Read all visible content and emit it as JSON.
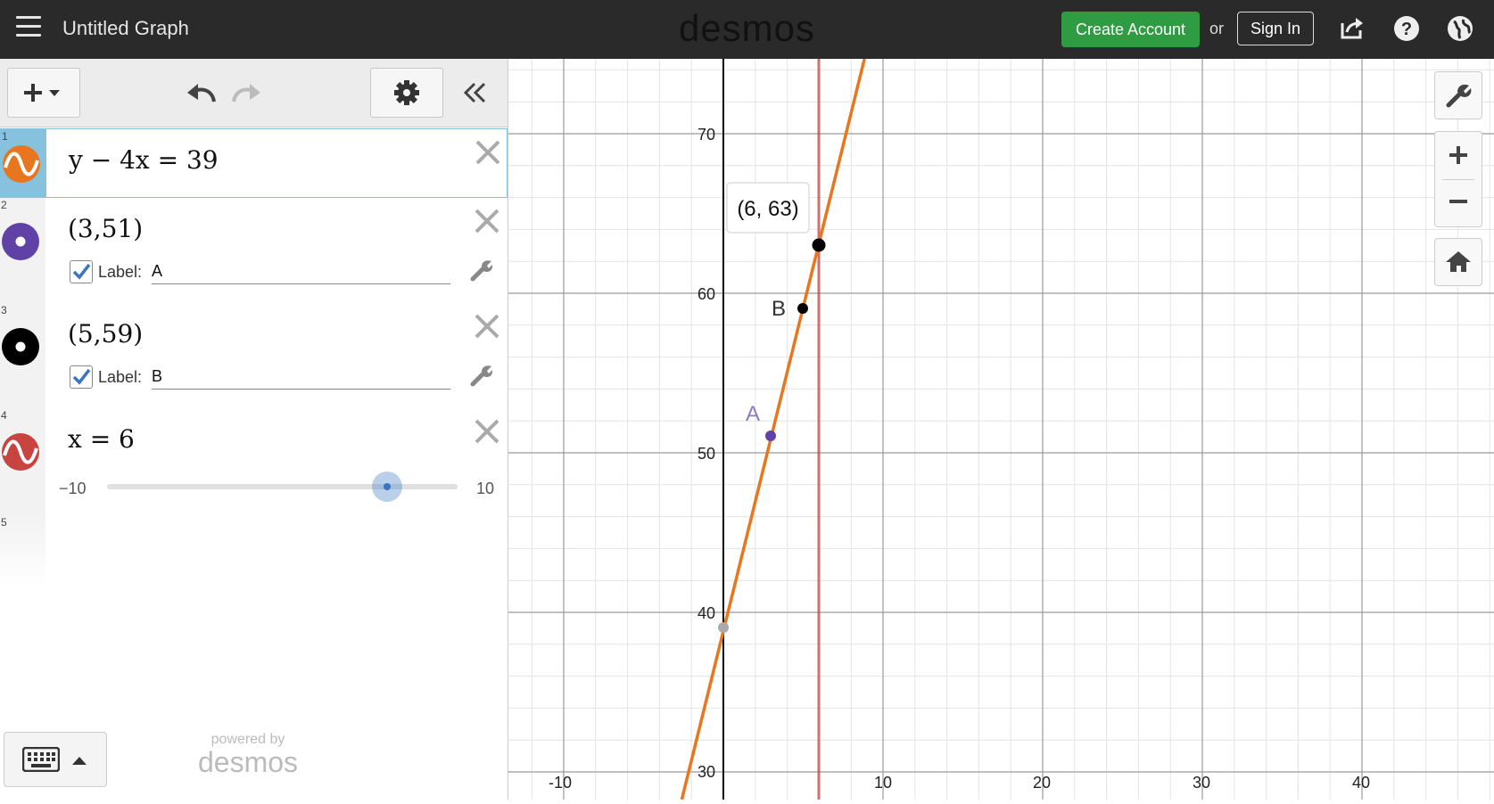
{
  "header": {
    "title": "Untitled Graph",
    "logo": "desmos",
    "create_account": "Create Account",
    "or": "or",
    "sign_in": "Sign In",
    "accent": "#2f9c43"
  },
  "expressions": [
    {
      "num": "1",
      "latex": "y − 4x = 39",
      "color": "#e8761f",
      "icon": "sine-wave-icon"
    },
    {
      "num": "2",
      "latex": "(3,51)",
      "color": "#6042a6",
      "label": "Label:",
      "label_value": "A",
      "icon": "point-icon"
    },
    {
      "num": "3",
      "latex": "(5,59)",
      "color": "#000000",
      "label": "Label:",
      "label_value": "B",
      "icon": "point-icon"
    },
    {
      "num": "4",
      "latex": "x = 6",
      "color": "#c74440",
      "icon": "sine-wave-icon",
      "slider": {
        "min": "−10",
        "max": "10",
        "value": 6
      }
    },
    {
      "num": "5"
    }
  ],
  "footer": {
    "powered": "powered by",
    "brand": "desmos"
  },
  "graph": {
    "x_ticks": [
      "-10",
      "10",
      "20",
      "30",
      "40"
    ],
    "y_ticks": [
      "70",
      "60",
      "50",
      "40",
      "30"
    ],
    "point_label_A": "A",
    "point_label_B": "B",
    "tooltip": "(6, 63)"
  }
}
